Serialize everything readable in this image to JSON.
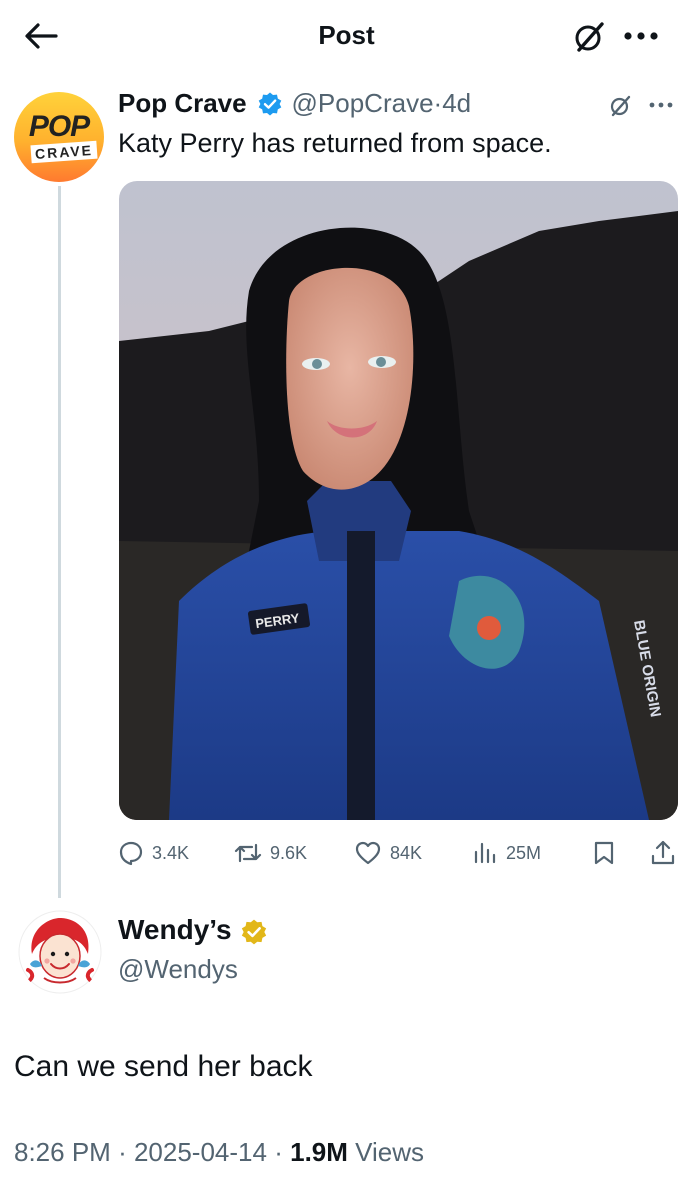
{
  "header": {
    "title": "Post",
    "icons": [
      "back-arrow-icon",
      "grok-icon",
      "more-icon"
    ]
  },
  "original_post": {
    "author_name": "Pop Crave",
    "avatar_text_top": "POP",
    "avatar_text_bottom": "CRAVE",
    "handle": "@PopCrave",
    "separator": "·",
    "time": "4d",
    "text": "Katy Perry has returned from space.",
    "photo_patch_label": "PERRY",
    "photo_sleeve_text": "BLUE ORIGIN",
    "stats": {
      "replies": "3.4K",
      "reposts": "9.6K",
      "likes": "84K",
      "views": "25M"
    },
    "verified_color": "#1d9bf0"
  },
  "reply": {
    "author_name": "Wendy’s",
    "handle": "@Wendys",
    "text": "Can we send her back",
    "time": "8:26 PM",
    "sep1": "·",
    "date": "2025-04-14",
    "sep2": "·",
    "views_count": "1.9M",
    "views_label": "Views",
    "verified_color": "#e2b719"
  }
}
